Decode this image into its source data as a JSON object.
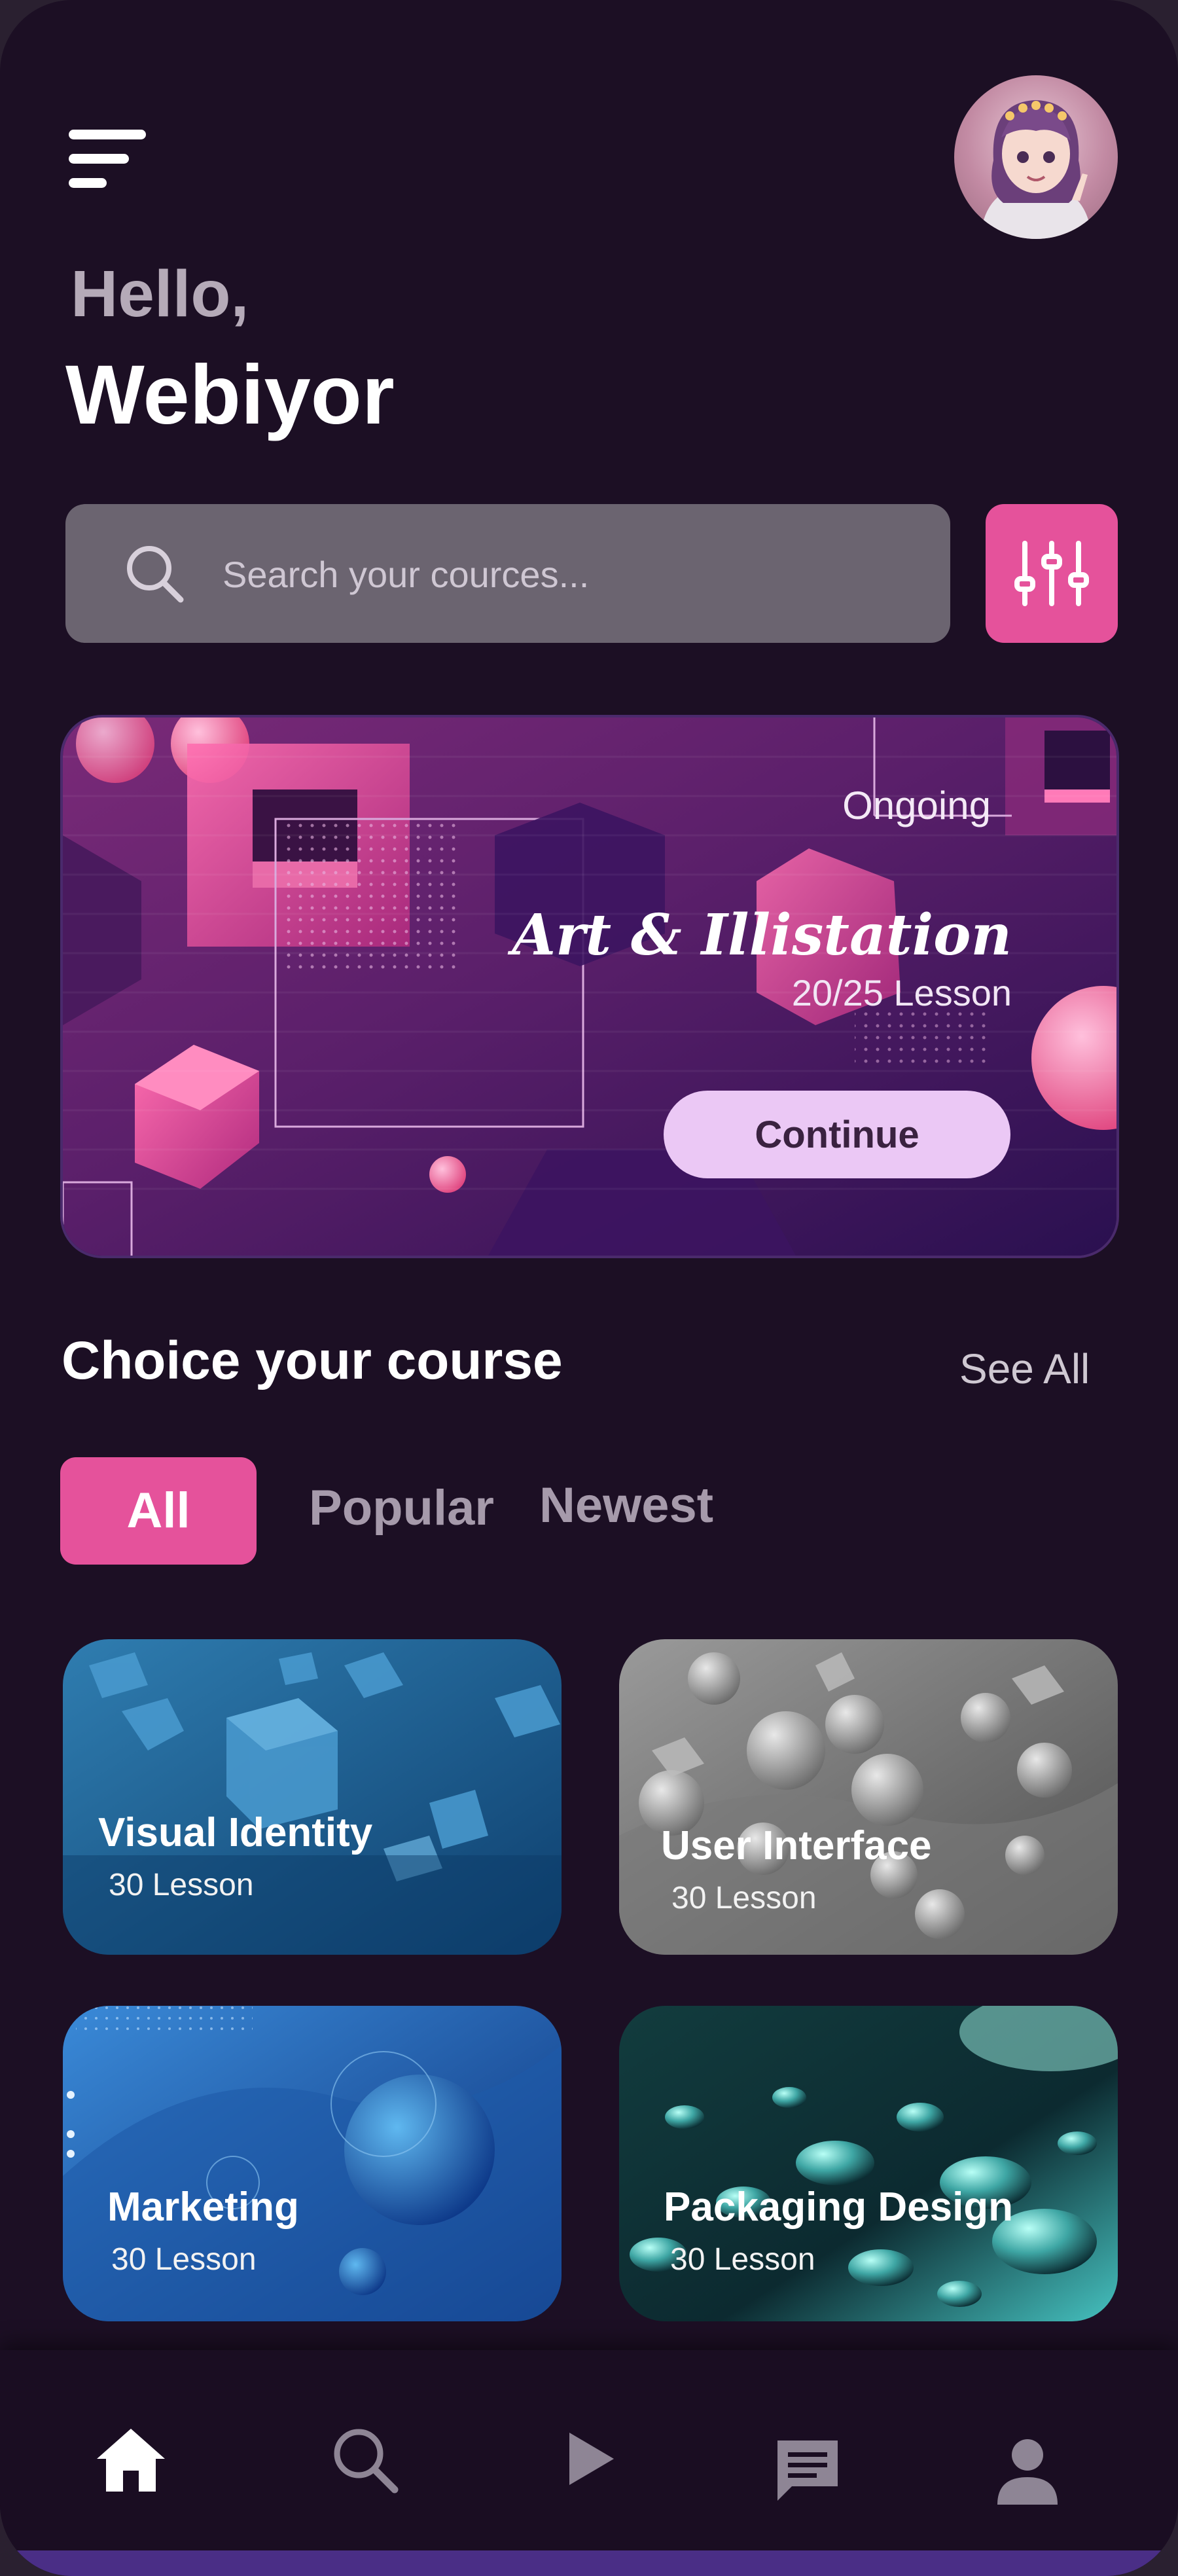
{
  "header": {
    "menu_icon": "hamburger-icon",
    "greeting": "Hello,",
    "user_name": "Webiyor",
    "avatar_icon": "user-avatar"
  },
  "search": {
    "placeholder": "Search your cources...",
    "icon": "search-icon",
    "filter_icon": "sliders-icon"
  },
  "banner": {
    "status": "Ongoing",
    "title": "Art & Illistation",
    "progress_text": "20/25 Lesson",
    "progress": 0.8,
    "button_label": "Continue"
  },
  "section": {
    "title": "Choice your course",
    "see_all": "See All"
  },
  "filters": {
    "tabs": [
      "All",
      "Popular",
      "Newest"
    ],
    "active": "All"
  },
  "courses": [
    {
      "title": "Visual Identity",
      "lessons": "30 Lesson"
    },
    {
      "title": "User Interface",
      "lessons": "30 Lesson"
    },
    {
      "title": "Marketing",
      "lessons": "30 Lesson"
    },
    {
      "title": "Packaging Design",
      "lessons": "30 Lesson"
    }
  ],
  "nav": {
    "items": [
      "home-icon",
      "search-icon",
      "play-icon",
      "chat-icon",
      "profile-icon"
    ],
    "active": "home-icon"
  },
  "colors": {
    "background": "#1c0f24",
    "accent": "#e5529b",
    "button_light": "#ebc8f5",
    "search_bg": "#6b6470"
  }
}
